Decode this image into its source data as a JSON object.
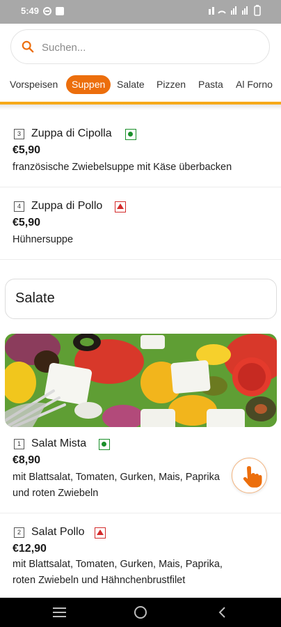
{
  "status_bar": {
    "time": "5:49"
  },
  "search": {
    "placeholder": "Suchen..."
  },
  "categories": [
    {
      "label": "Vorspeisen",
      "active": false
    },
    {
      "label": "Suppen",
      "active": true
    },
    {
      "label": "Salate",
      "active": false
    },
    {
      "label": "Pizzen",
      "active": false
    },
    {
      "label": "Pasta",
      "active": false
    },
    {
      "label": "Al Forno",
      "active": false
    }
  ],
  "soups": [
    {
      "number": "3",
      "name": "Zuppa di Cipolla",
      "badge": "veg-icon",
      "price": "€5,90",
      "description": "französische Zwiebelsuppe mit Käse überbacken"
    },
    {
      "number": "4",
      "name": "Zuppa di Pollo",
      "badge": "nonveg-icon",
      "price": "€5,90",
      "description": "Hühnersuppe"
    }
  ],
  "salad_section": {
    "title": "Salate",
    "items": [
      {
        "number": "1",
        "name": "Salat Mista",
        "badge": "veg-icon",
        "price": "€8,90",
        "description_line1": "mit Blattsalat, Tomaten, Gurken, Mais, Paprika",
        "description_line2": "und roten Zwiebeln"
      },
      {
        "number": "2",
        "name": "Salat Pollo",
        "badge": "nonveg-icon",
        "price": "€12,90",
        "description_line1": "mit Blattsalat, Tomaten, Gurken, Mais, Paprika,",
        "description_line2": "roten Zwiebeln und Hähnchenbrustfilet"
      }
    ]
  },
  "colors": {
    "accent": "#ec6e0c",
    "accent_line": "#f6a91a",
    "veg": "#1a8f2a",
    "nonveg": "#d32b2b"
  }
}
